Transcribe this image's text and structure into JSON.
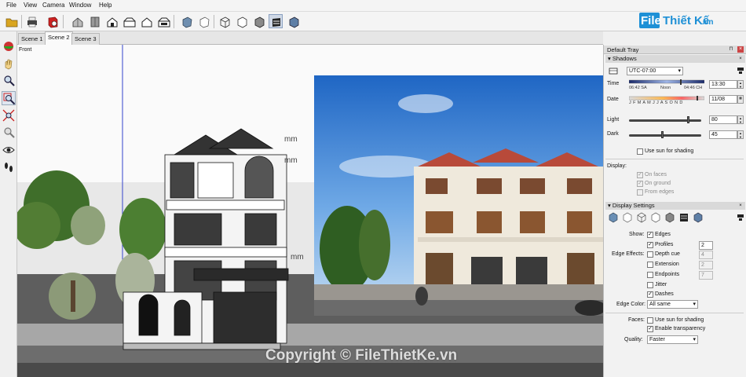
{
  "menu": [
    "File",
    "View",
    "Camera",
    "Window",
    "Help"
  ],
  "logo": {
    "brand_file": "File",
    "brand_name": "Thiết Kế",
    "brand_suffix": ".vn"
  },
  "scenes": {
    "tab1": "Scene 1",
    "tab2": "Scene 2",
    "tab3": "Scene 3"
  },
  "viewport": {
    "camera_label": "Front",
    "dim_label_1": "mm",
    "dim_label_2": "mm",
    "dim_label_3": "mm",
    "copyright": "Copyright © FileThietKe.vn"
  },
  "tray": {
    "title": "Default Tray",
    "pin_icon": "pin-icon",
    "shadows": {
      "title": "Shadows",
      "timezone": "UTC-07:00",
      "time_label": "Time",
      "time_start": "06:42 SA",
      "time_noon": "Noon",
      "time_end": "04:46 CH",
      "time_value": "13:30",
      "date_label": "Date",
      "months": "J F M A M J J A S O N D",
      "date_value": "11/08",
      "light_label": "Light",
      "light_value": "80",
      "light_level_pct": 80,
      "dark_label": "Dark",
      "dark_value": "45",
      "dark_level_pct": 45,
      "use_sun": "Use sun for shading",
      "display_label": "Display:",
      "on_faces": "On faces",
      "on_ground": "On ground",
      "from_edges": "From edges"
    },
    "display_settings": {
      "title": "Display Settings",
      "show_label": "Show:",
      "edges": "Edges",
      "profiles": "Profiles",
      "profiles_value": "2",
      "edge_effects_label": "Edge Effects:",
      "depth_cue": "Depth cue",
      "depth_cue_value": "4",
      "extension": "Extension",
      "extension_value": "2",
      "endpoints": "Endpoints",
      "endpoints_value": "7",
      "jitter": "Jitter",
      "dashes": "Dashes",
      "edge_color_label": "Edge Color:",
      "edge_color_value": "All same",
      "faces_label": "Faces:",
      "faces_use_sun": "Use sun for shading",
      "enable_transparency": "Enable transparency",
      "quality_label": "Quality:",
      "quality_value": "Faster"
    }
  }
}
